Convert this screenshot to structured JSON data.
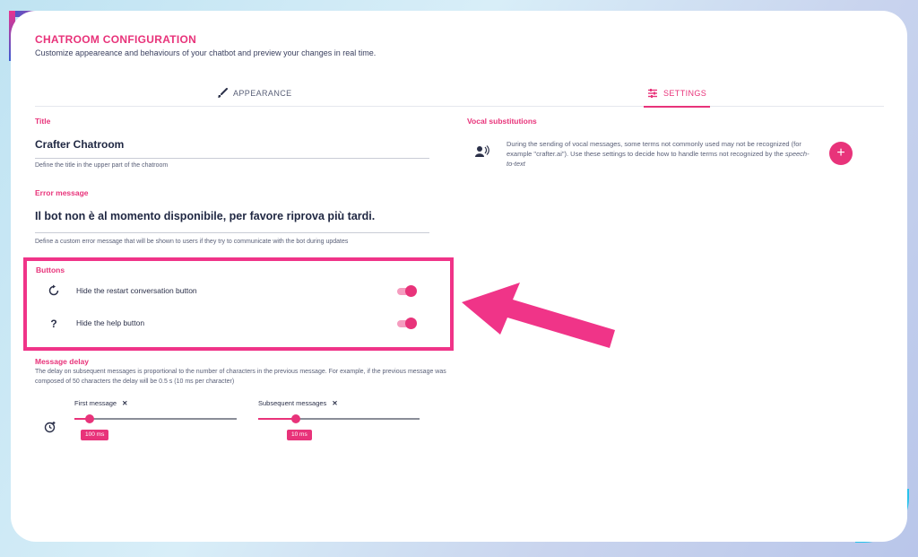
{
  "header": {
    "title": "CHATROOM CONFIGURATION",
    "subtitle": "Customize appeareance and behaviours of your chatbot and preview your changes in real time."
  },
  "tabs": [
    {
      "label": "APPEARANCE",
      "icon": "brush-icon",
      "active": false
    },
    {
      "label": "SETTINGS",
      "icon": "sliders-icon",
      "active": true
    }
  ],
  "title_field": {
    "label": "Title",
    "value": "Crafter Chatroom",
    "hint": "Define the title in the upper part of the chatroom"
  },
  "error_field": {
    "label": "Error message",
    "value": "Il bot non è al momento disponibile, per favore riprova più tardi.",
    "hint": "Define a custom error message that will be shown to users if they try to communicate with the bot during updates"
  },
  "buttons_section": {
    "label": "Buttons",
    "items": [
      {
        "label": "Hide the restart conversation button",
        "icon": "restart-icon",
        "enabled": true
      },
      {
        "label": "Hide the help button",
        "icon": "?",
        "enabled": true
      }
    ]
  },
  "message_delay": {
    "label": "Message delay",
    "description": "The delay on subsequent messages is proportional to the number of characters in the previous message. For example, if the previous message was composed of 50 characters the delay will be 0.5 s (10 ms per character)",
    "first": {
      "label": "First message",
      "close": "✕",
      "value": "100 ms"
    },
    "subsequent": {
      "label": "Subsequent messages",
      "close": "✕",
      "value": "10 ms"
    }
  },
  "vocal": {
    "label": "Vocal substitutions",
    "text_before": "During the sending of vocal messages, some terms not commonly used may not be recognized (for example \"crafter.ai\"). Use these settings to decide how to handle terms not recognized by the ",
    "text_em": "speech-to-text",
    "add": "+"
  },
  "colors": {
    "accent": "#e8337a",
    "highlight_border": "#f03488",
    "text": "#1f2742"
  }
}
